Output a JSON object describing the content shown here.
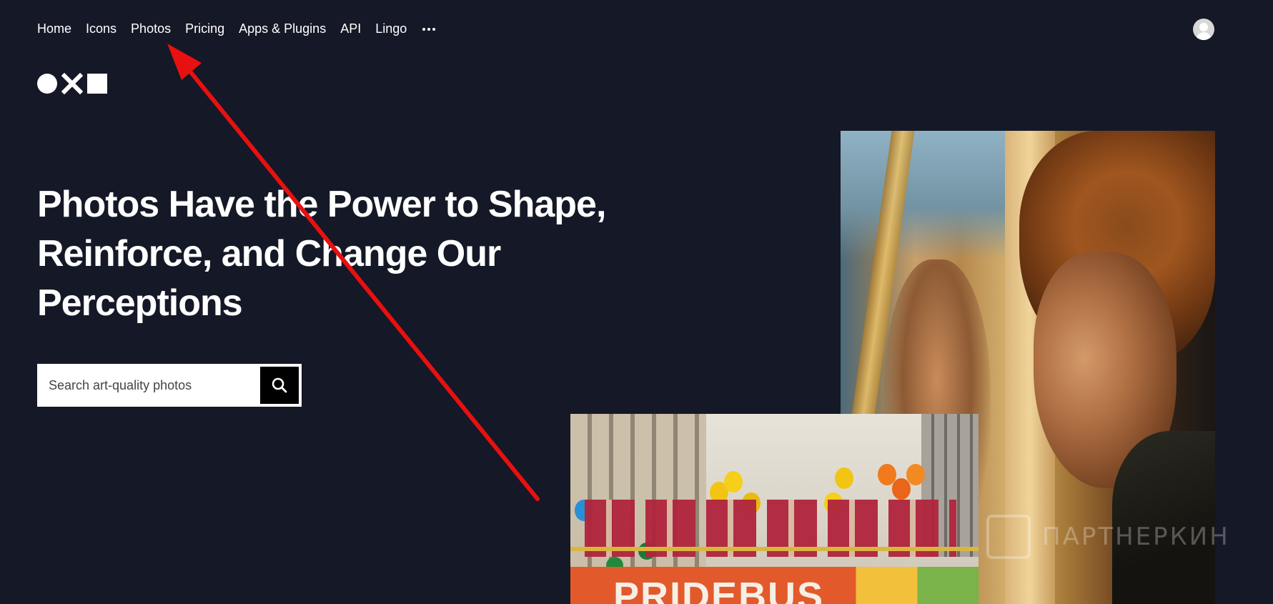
{
  "nav": {
    "items": [
      {
        "label": "Home"
      },
      {
        "label": "Icons"
      },
      {
        "label": "Photos"
      },
      {
        "label": "Pricing"
      },
      {
        "label": "Apps & Plugins"
      },
      {
        "label": "API"
      },
      {
        "label": "Lingo"
      }
    ],
    "more_icon": "more-horizontal-icon"
  },
  "logo": {
    "icons": [
      "circle-icon",
      "x-icon",
      "square-icon"
    ]
  },
  "hero": {
    "headline_line1": "Photos Have the Power to Shape,",
    "headline_line2": "Reinforce, and Change Our",
    "headline_line3": "Perceptions"
  },
  "search": {
    "placeholder": "Search art-quality photos",
    "value": "",
    "button_icon": "search-icon"
  },
  "photos": {
    "parade_banner_text": "PRIDEBUS"
  },
  "annotation": {
    "color": "#e81010"
  },
  "watermark": {
    "text": "ПАРТНЕРКИН"
  },
  "colors": {
    "background": "#151826",
    "search_button": "#000000",
    "text": "#ffffff"
  }
}
